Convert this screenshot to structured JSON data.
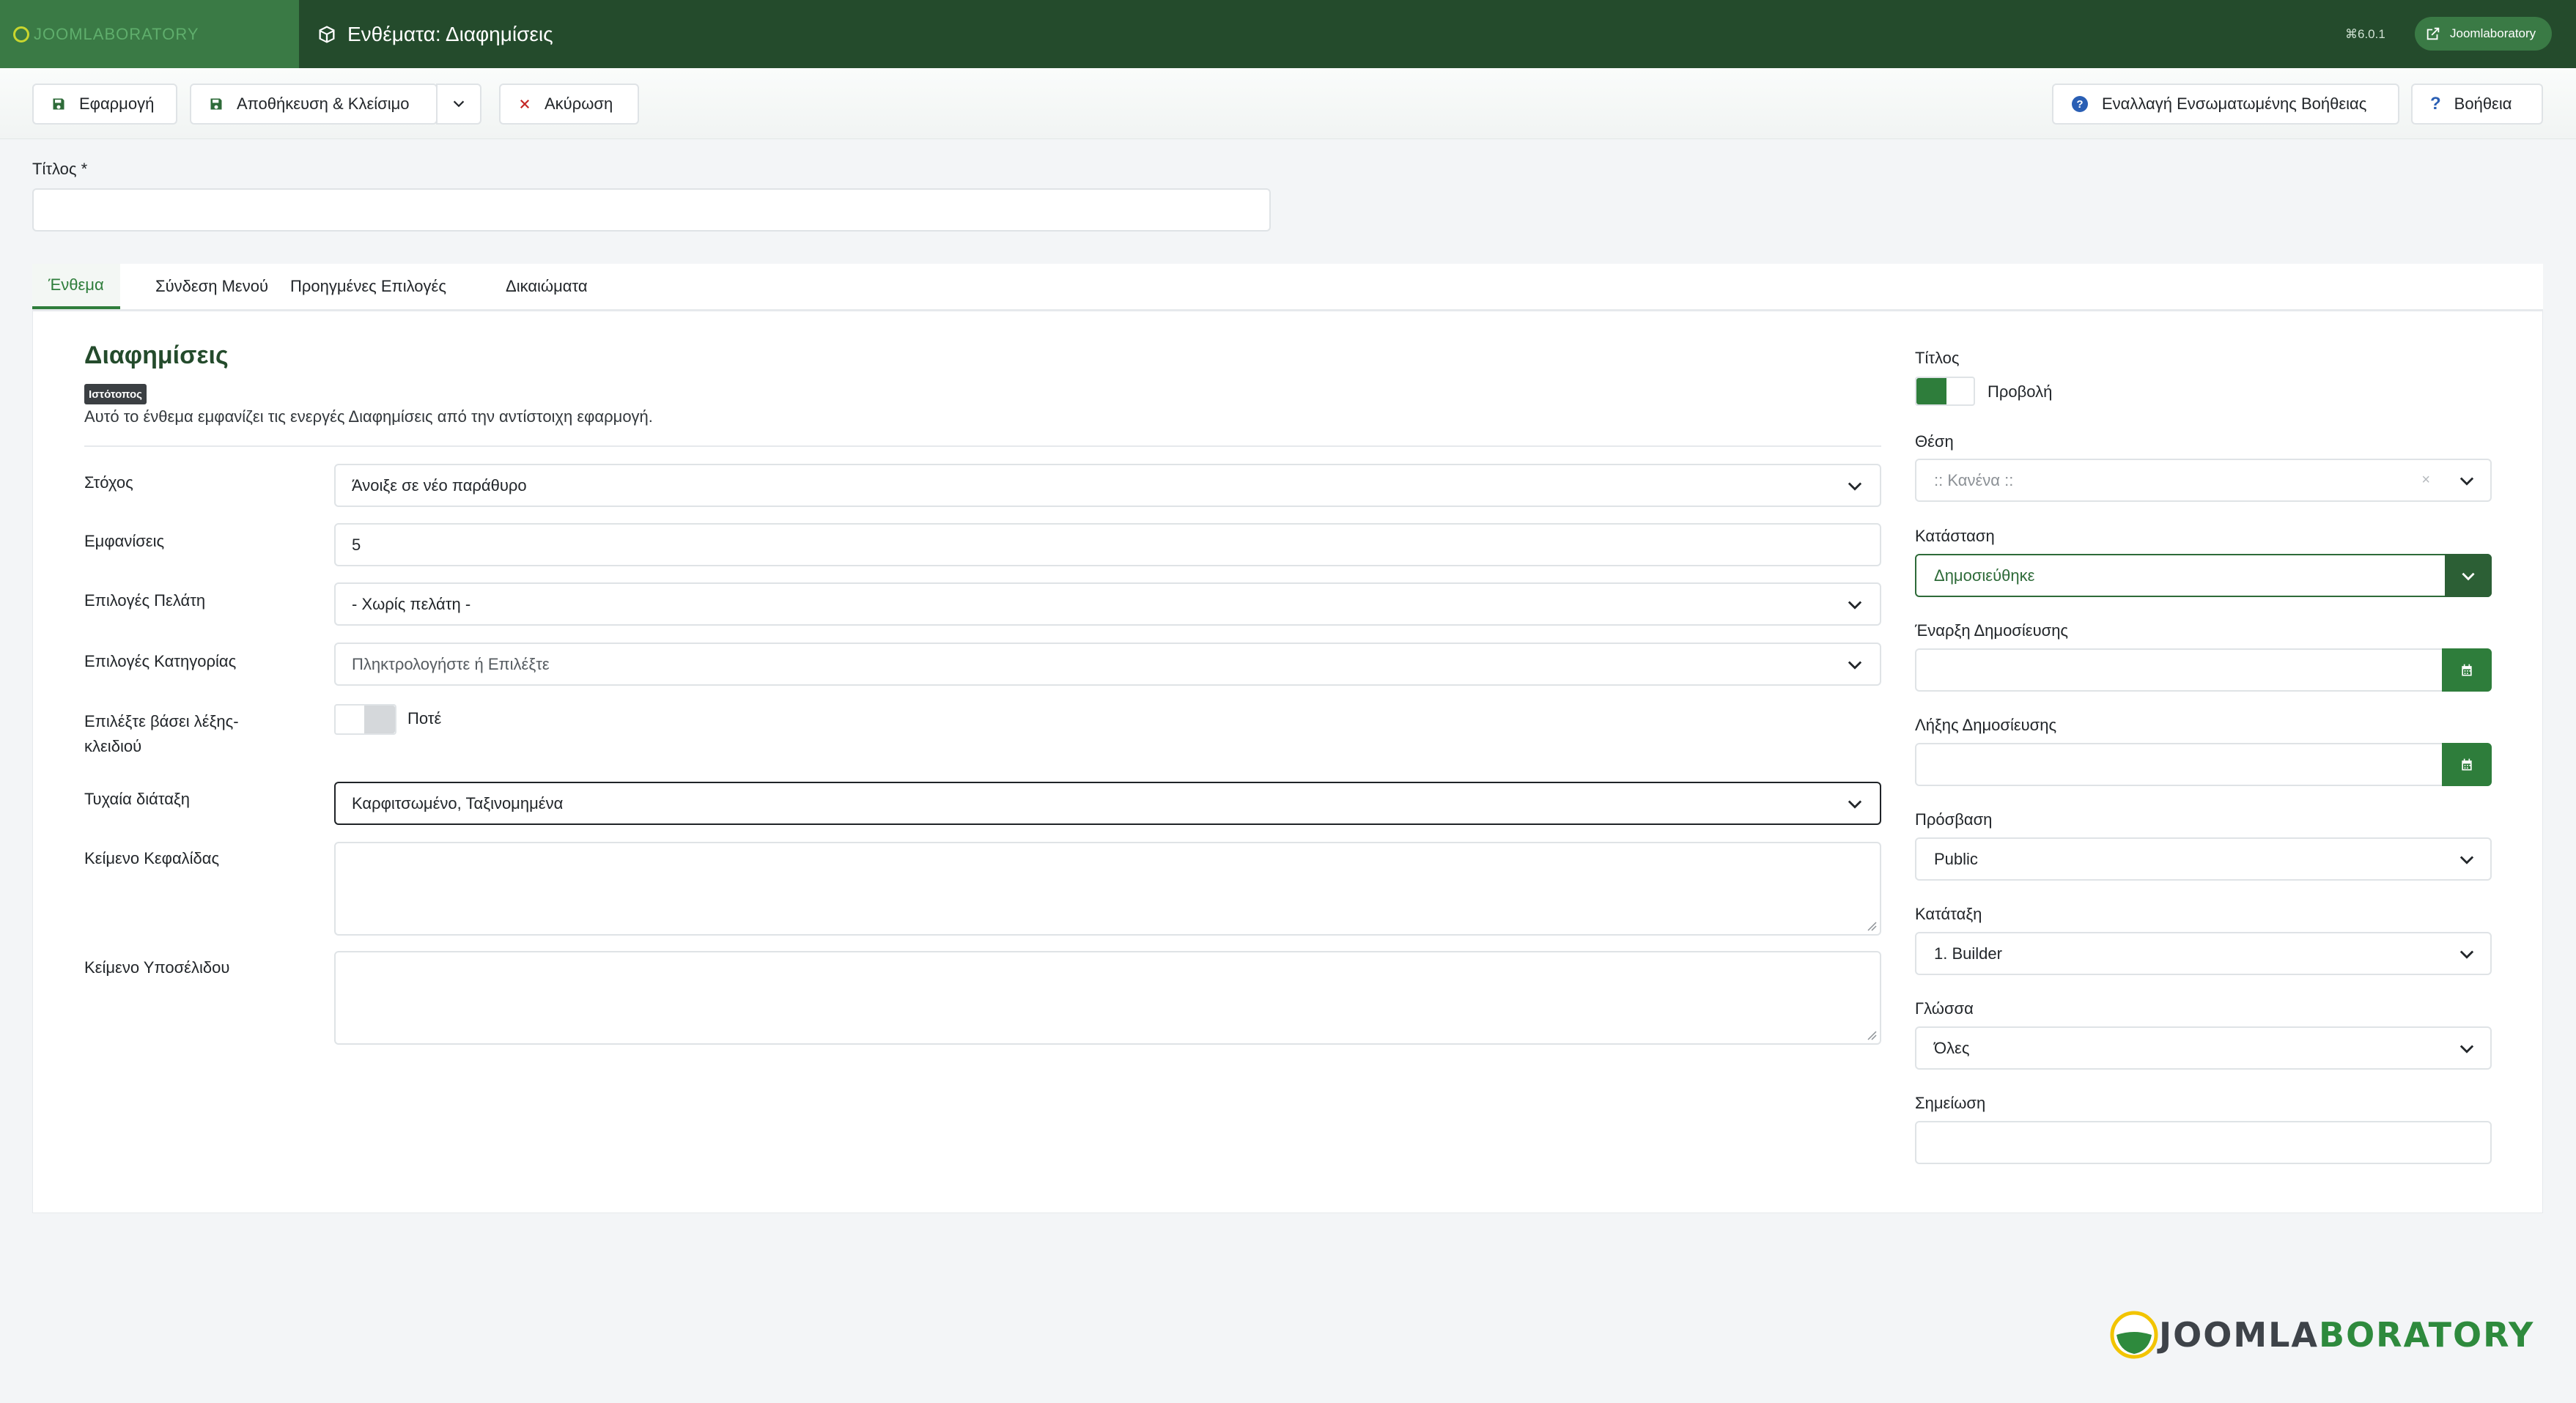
{
  "header": {
    "logo_text": "JOOMLABORATORY",
    "title": "Ενθέματα: Διαφημίσεις",
    "version": "⌘6.0.1",
    "site_button": "Joomlaboratory"
  },
  "toolbar": {
    "apply": "Εφαρμογή",
    "save_close": "Αποθήκευση & Κλείσιμο",
    "cancel": "Ακύρωση",
    "inline_help": "Εναλλαγή Ενσωματωμένης Βοήθειας",
    "help": "Βοήθεια"
  },
  "title_field": {
    "label": "Τίτλος *",
    "value": ""
  },
  "tabs": [
    {
      "label": "Ένθεμα",
      "active": true
    },
    {
      "label": "Σύνδεση Μενού",
      "active": false
    },
    {
      "label": "Προηγμένες Επιλογές",
      "active": false
    },
    {
      "label": "Δικαιώματα",
      "active": false
    }
  ],
  "module": {
    "name": "Διαφημίσεις",
    "badge": "Ιστότοπος",
    "description": "Αυτό το ένθεμα εμφανίζει τις ενεργές Διαφημίσεις από την αντίστοιχη εφαρμογή."
  },
  "fields": {
    "target": {
      "label": "Στόχος",
      "value": "Άνοιξε σε νέο παράθυρο"
    },
    "count": {
      "label": "Εμφανίσεις",
      "value": "5"
    },
    "client": {
      "label": "Επιλογές Πελάτη",
      "value": "- Χωρίς πελάτη -"
    },
    "category": {
      "label": "Επιλογές Κατηγορίας",
      "placeholder": "Πληκτρολογήστε ή Επιλέξτε"
    },
    "keyword": {
      "label": "Επιλέξτε βάσει λέξης-κλειδιού",
      "value": "Ποτέ",
      "on": false
    },
    "ordering": {
      "label": "Τυχαία διάταξη",
      "value": "Καρφιτσωμένο, Ταξινομημένα"
    },
    "header_text": {
      "label": "Κείμενο Κεφαλίδας",
      "value": ""
    },
    "footer_text": {
      "label": "Κείμενο Υποσέλιδου",
      "value": ""
    }
  },
  "side": {
    "show_title": {
      "label": "Τίτλος",
      "value": "Προβολή",
      "on": true
    },
    "position": {
      "label": "Θέση",
      "value": ":: Κανένα ::"
    },
    "status": {
      "label": "Κατάσταση",
      "value": "Δημοσιεύθηκε"
    },
    "publish_up": {
      "label": "Έναρξη Δημοσίευσης",
      "value": ""
    },
    "publish_down": {
      "label": "Λήξης Δημοσίευσης",
      "value": ""
    },
    "access": {
      "label": "Πρόσβαση",
      "value": "Public"
    },
    "ordering": {
      "label": "Κατάταξη",
      "value": "1. Builder"
    },
    "language": {
      "label": "Γλώσσα",
      "value": "Όλες"
    },
    "note": {
      "label": "Σημείωση",
      "value": ""
    }
  },
  "footer_logo": {
    "part1": "JOOMLA",
    "part2": "BORATORY"
  },
  "colors": {
    "header": "#244b2c",
    "accent": "#2e7d3b",
    "logo_box": "#3a7a45"
  }
}
